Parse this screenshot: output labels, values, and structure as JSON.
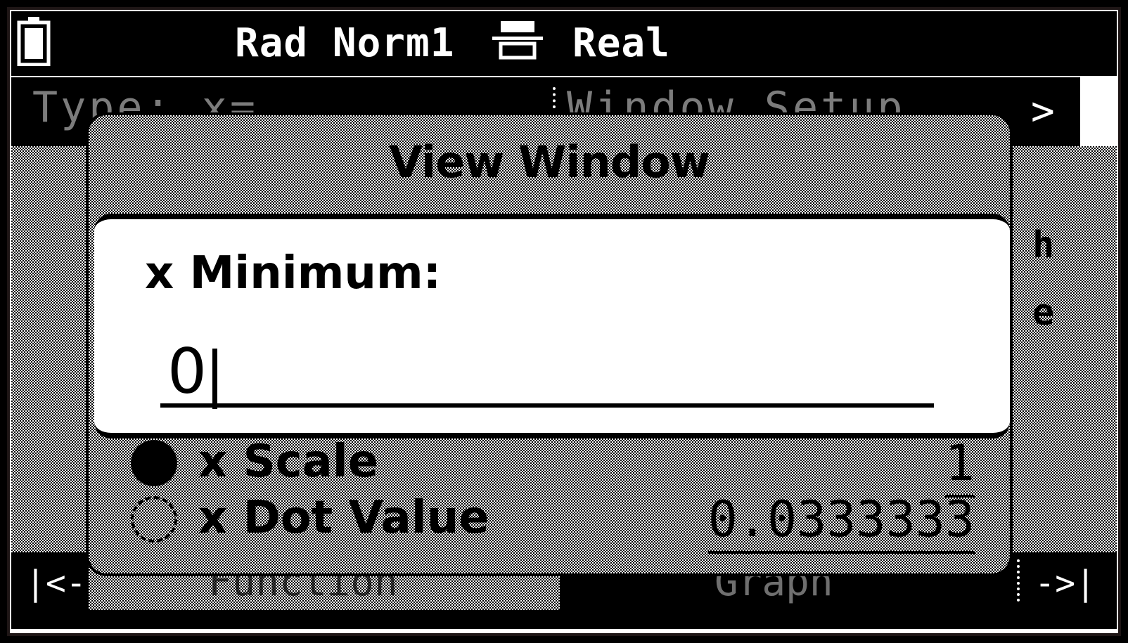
{
  "status_bar": {
    "angle_format": "Rad Norm1",
    "complex_mode": "Real",
    "battery_icon": "battery-icon",
    "printer_icon": "printer-icon"
  },
  "background": {
    "tab_left": "Type: x=",
    "tab_right": "Window Setup",
    "tab_arrow": ">",
    "side_tab_1": "h",
    "side_tab_2": "e",
    "bottom_left_arrow": "|<-",
    "bottom_right_arrow": "->|",
    "function_label": "Function",
    "graph_label": "Graph"
  },
  "dialog": {
    "title": "View Window",
    "rows": [
      {
        "label": "x Scale",
        "value": "1"
      },
      {
        "label": "x Dot Value",
        "value": "0.0333333"
      }
    ]
  },
  "input": {
    "label": "x Minimum:",
    "value": "0"
  }
}
